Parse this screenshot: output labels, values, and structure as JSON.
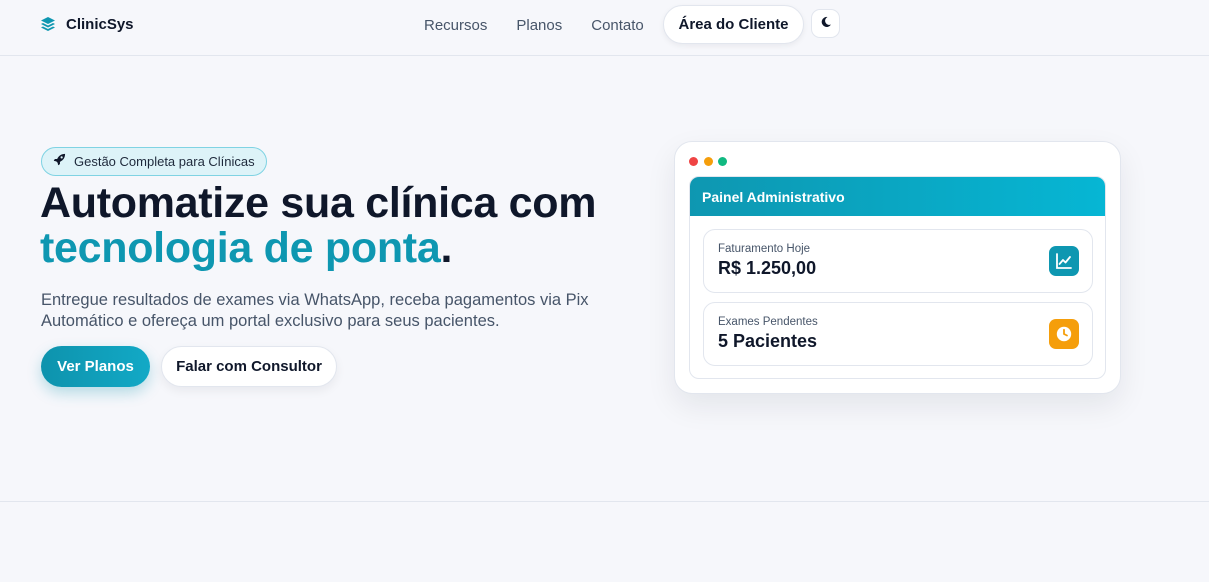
{
  "nav": {
    "brand": "ClinicSys",
    "links": [
      "Recursos",
      "Planos",
      "Contato"
    ],
    "client_area": "Área do Cliente",
    "theme_icon": "moon-icon"
  },
  "hero": {
    "badge": "Gestão Completa para Clínicas",
    "badge_icon": "rocket-icon",
    "title_line1": "Automatize sua clínica com",
    "title_accent": "tecnologia de ponta",
    "title_end": ".",
    "subtitle": "Entregue resultados de exames via WhatsApp, receba pagamentos via Pix Automático e ofereça um portal exclusivo para seus pacientes.",
    "primary_cta": "Ver Planos",
    "secondary_cta": "Falar com Consultor"
  },
  "mockup": {
    "panel_title": "Painel Administrativo",
    "stats": [
      {
        "label": "Faturamento Hoje",
        "value": "R$ 1.250,00",
        "icon": "chart-line-icon",
        "color": "#0e97b1"
      },
      {
        "label": "Exames Pendentes",
        "value": "5 Pacientes",
        "icon": "clock-icon",
        "color": "#f59e0b"
      }
    ]
  },
  "colors": {
    "accent": "#0e97b1",
    "background": "#f6f7fb",
    "text": "#0f172a",
    "muted": "#475569",
    "window_red": "#ef4444",
    "window_yellow": "#f59e0b",
    "window_green": "#10b981"
  }
}
